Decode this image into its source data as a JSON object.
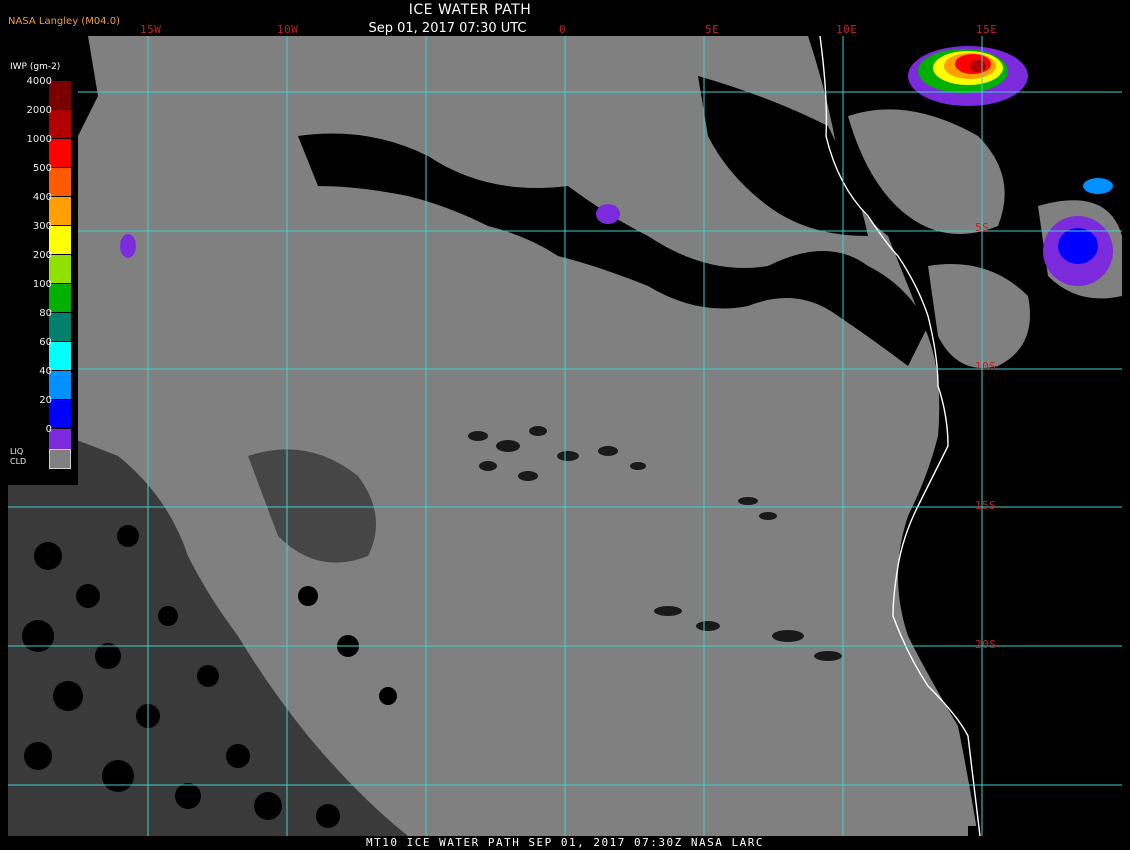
{
  "header": {
    "source_label": "NASA Langley (M04.0)",
    "title": "ICE WATER PATH",
    "timestamp": "Sep 01, 2017 07:30 UTC"
  },
  "map": {
    "longitude_labels": [
      "15W",
      "10W",
      "0",
      "5E",
      "10E",
      "15E"
    ],
    "latitude_labels": [
      "5S",
      "10S",
      "15S",
      "20S"
    ],
    "colors": {
      "gridline": "#40d0d0",
      "coastline": "#ffffff",
      "liquid_cloud": "#808080",
      "clear": "#000000",
      "grid_label": "#c82020"
    }
  },
  "legend": {
    "title": "IWP (gm-2)",
    "ticks": [
      "4000",
      "2000",
      "1000",
      "500",
      "400",
      "300",
      "200",
      "100",
      "80",
      "60",
      "40",
      "20",
      "0"
    ],
    "colors": [
      "#7a0000",
      "#b00000",
      "#ff0000",
      "#ff5a00",
      "#ffa000",
      "#ffff00",
      "#90e000",
      "#00b000",
      "#00806a",
      "#00ffff",
      "#0090ff",
      "#0000ff",
      "#7b2bdb"
    ],
    "liquid_cloud_label_1": "LIQ",
    "liquid_cloud_label_2": "CLD"
  },
  "footer": {
    "text": "MT10  ICE WATER PATH   SEP 01, 2017 07:30Z   NASA LARC"
  }
}
